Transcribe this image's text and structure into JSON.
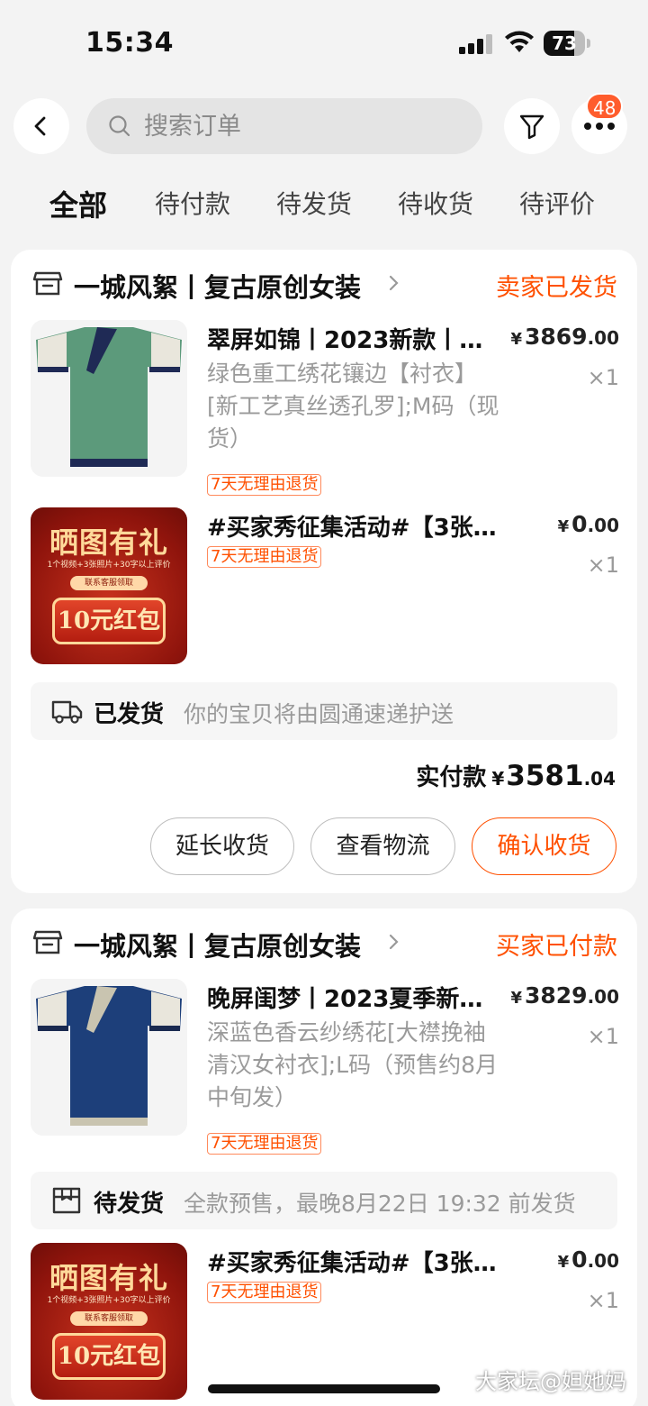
{
  "status_bar": {
    "time": "15:34",
    "battery": "73",
    "battery_level": 0.73
  },
  "header": {
    "search_placeholder": "搜索订单",
    "badge_count": "48"
  },
  "tabs": [
    "全部",
    "待付款",
    "待发货",
    "待收货",
    "待评价"
  ],
  "orders": [
    {
      "shop_name": "一城风絮丨复古原创女装",
      "status": "卖家已发货",
      "items": [
        {
          "title": "翠屏如锦丨2023新款丨…",
          "spec": "绿色重工绣花镶边【衬衣】[新工艺真丝透孔罗];M码（现货）",
          "price_int": "3869",
          "price_dec": ".00",
          "qty": "×1",
          "tag": "7天无理由退货",
          "color": "#5c9a7b"
        },
        {
          "title": "#买家秀征集活动#【3张图…",
          "price_int": "0",
          "price_dec": ".00",
          "qty": "×1",
          "tag": "7天无理由退货",
          "promo": {
            "title": "晒图有礼",
            "line": "1个视频+3张照片+30字以上评价",
            "contact": "联系客服领取",
            "reward": "10元红包"
          }
        }
      ],
      "shipping": {
        "status": "已发货",
        "desc": "你的宝贝将由圆通速递护送"
      },
      "total": {
        "label": "实付款",
        "yen": "¥",
        "int": "3581",
        "dec": ".04"
      },
      "buttons": [
        "延长收货",
        "查看物流",
        "确认收货"
      ]
    },
    {
      "shop_name": "一城风絮丨复古原创女装",
      "status": "买家已付款",
      "items": [
        {
          "title": "晚屏闺梦丨2023夏季新…",
          "spec": "深蓝色香云纱绣花[大襟挽袖清汉女衬衣];L码（预售约8月中旬发）",
          "price_int": "3829",
          "price_dec": ".00",
          "qty": "×1",
          "tag": "7天无理由退货",
          "color": "#1d3f7a"
        },
        {
          "title": "#买家秀征集活动#【3张图…",
          "price_int": "0",
          "price_dec": ".00",
          "qty": "×1",
          "tag": "7天无理由退货",
          "promo": {
            "title": "晒图有礼",
            "line": "1个视频+3张照片+30字以上评价",
            "contact": "联系客服领取",
            "reward": "10元红包"
          }
        }
      ],
      "shipping": {
        "status": "待发货",
        "desc": "全款预售，最晚8月22日 19:32 前发货"
      }
    }
  ],
  "yen": "¥",
  "watermark": "大家坛@妲她妈"
}
